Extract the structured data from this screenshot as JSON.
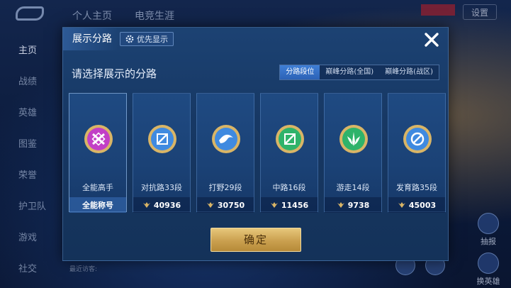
{
  "background": {
    "top_tabs": [
      "个人主页",
      "电竞生涯"
    ],
    "settings_label": "设置",
    "left_nav": [
      "主页",
      "战绩",
      "英雄",
      "图鉴",
      "荣誉",
      "护卫队",
      "游戏",
      "社交"
    ],
    "bottom_hint": "最近访客:",
    "right_badge": "抽报",
    "right_badge2": "换英雄"
  },
  "dialog": {
    "title": "展示分路",
    "priority_label": "优先显示",
    "subtitle": "请选择展示的分路",
    "tabs": [
      {
        "label": "分路段位",
        "active": true
      },
      {
        "label": "巅峰分路(全国)",
        "active": false
      },
      {
        "label": "巅峰分路(战区)",
        "active": false
      }
    ],
    "cards": [
      {
        "label": "全能高手",
        "value": "全能称号",
        "emblem": "all-round-emblem-icon",
        "color": "#c23fc6",
        "selected": true,
        "show_power": false
      },
      {
        "label": "对抗路33段",
        "value": "40936",
        "emblem": "clash-lane-emblem-icon",
        "color": "#3f8ae0",
        "selected": false,
        "show_power": true
      },
      {
        "label": "打野29段",
        "value": "30750",
        "emblem": "jungle-emblem-icon",
        "color": "#3f8ae0",
        "selected": false,
        "show_power": true
      },
      {
        "label": "中路16段",
        "value": "11456",
        "emblem": "mid-lane-emblem-icon",
        "color": "#2fb36a",
        "selected": false,
        "show_power": true
      },
      {
        "label": "游走14段",
        "value": "9738",
        "emblem": "roam-emblem-icon",
        "color": "#2fb36a",
        "selected": false,
        "show_power": true
      },
      {
        "label": "发育路35段",
        "value": "45003",
        "emblem": "farm-lane-emblem-icon",
        "color": "#3f8ae0",
        "selected": false,
        "show_power": true
      }
    ],
    "confirm_label": "确定"
  },
  "colors": {
    "gold": "#d9b566",
    "accent_blue": "#3f7fd6"
  }
}
